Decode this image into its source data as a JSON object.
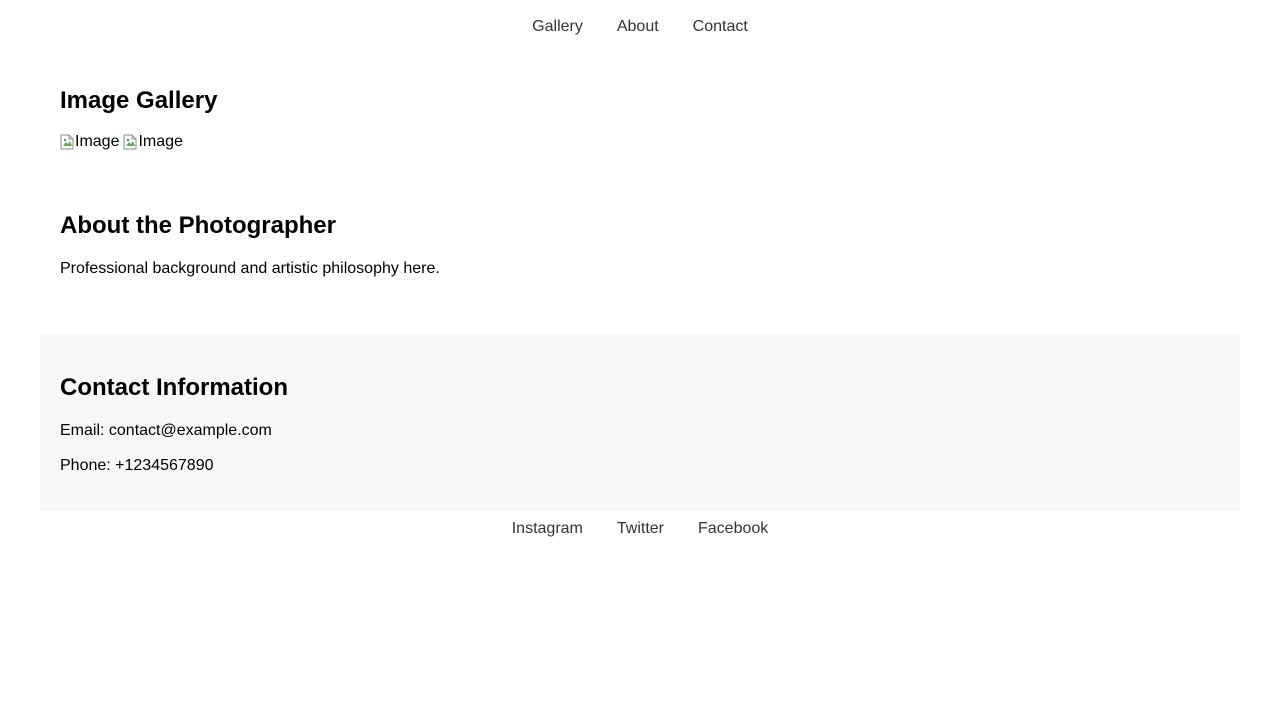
{
  "nav": {
    "items": [
      {
        "label": "Gallery"
      },
      {
        "label": "About"
      },
      {
        "label": "Contact"
      }
    ]
  },
  "gallery": {
    "title": "Image Gallery",
    "images": [
      {
        "alt": "Image",
        "icon": "broken-image-icon"
      },
      {
        "alt": "Image",
        "icon": "broken-image-icon"
      }
    ]
  },
  "about": {
    "title": "About the Photographer",
    "text": "Professional background and artistic philosophy here."
  },
  "contact": {
    "title": "Contact Information",
    "email": "Email: contact@example.com",
    "phone": "Phone: +1234567890",
    "background": "#f7f7f7"
  },
  "social": {
    "items": [
      {
        "label": "Instagram"
      },
      {
        "label": "Twitter"
      },
      {
        "label": "Facebook"
      }
    ]
  },
  "colors": {
    "link": "#333333",
    "text": "#000000"
  }
}
